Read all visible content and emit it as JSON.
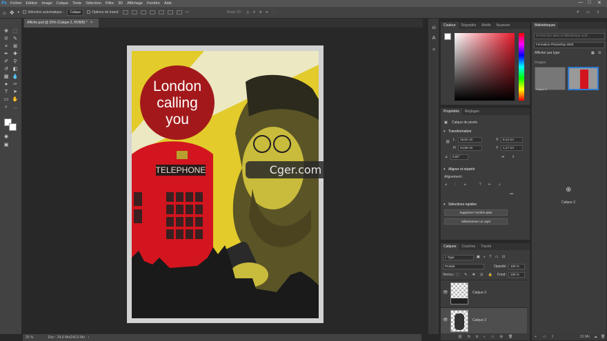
{
  "menubar": {
    "logo": "Ps",
    "items": [
      "Fichier",
      "Edition",
      "Image",
      "Calque",
      "Texte",
      "Sélection",
      "Filtre",
      "3D",
      "Affichage",
      "Fenêtre",
      "Aide"
    ],
    "minimize": "—",
    "maximize": "□",
    "close": "✕"
  },
  "options": {
    "auto_select_label": "Sélection automatique :",
    "auto_select_value": "Calque",
    "transform_label": "Options de transf.",
    "mode3d_label": "Mode 3D :"
  },
  "document": {
    "tab_title": "Affiche.psd @ 25% (Calque 2, RVB/8) *",
    "tab_close": "×",
    "zoom": "25 %",
    "doc_info": "Doc : 24,9 Mo/242,5 Mo"
  },
  "poster": {
    "headline_line1": "London",
    "headline_line2": "calling",
    "headline_line3": "you",
    "booth_sign": "TELEPHONE",
    "colors": {
      "yellow": "#e2cb2a",
      "cream": "#ece8c2",
      "red": "#a3191b",
      "booth_red": "#d2151e",
      "silhouette": "#1a1a1a"
    }
  },
  "watermark": {
    "text": "Cger.com"
  },
  "color_panel": {
    "tabs": [
      "Couleur",
      "Dégradés",
      "Motifs",
      "Nuancier"
    ]
  },
  "properties_panel": {
    "tabs": [
      "Propriétés",
      "Réglages"
    ],
    "layer_kind": "Calque de pixels",
    "transform_section": "Transformation",
    "w_label": "L",
    "w_value": "15,91 cm",
    "h_label": "H",
    "h_value": "24,86 cm",
    "x_label": "X",
    "x_value": "9,14 cm",
    "y_label": "Y",
    "y_value": "1,17 cm",
    "angle_value": "0,00°",
    "align_section": "Aligner et répartir",
    "align_label": "Alignement :",
    "more": "•••",
    "quick_section": "Sélections rapides",
    "remove_bg_button": "Supprimer l'arrière-plan",
    "select_subject_button": "Sélectionner un sujet"
  },
  "layers_panel": {
    "tabs": [
      "Calques",
      "Couches",
      "Tracés"
    ],
    "filter_type": "Type",
    "blend_mode": "Produit",
    "opacity_label": "Opacité :",
    "opacity_value": "100 %",
    "lock_label": "Verrou :",
    "fill_label": "Fond :",
    "fill_value": "100 %",
    "layers": [
      {
        "name": "Calque 3"
      },
      {
        "name": "Calque 2"
      }
    ],
    "footer_icons": "fx"
  },
  "libraries_panel": {
    "tab": "Bibliothèques",
    "search_placeholder": "Rechercher dans la bibliothèque actif...",
    "library_name": "Formation Photoshop 2020",
    "view_label": "Afficher par type",
    "section": "Images",
    "thumb1_label": "Calque 2",
    "add_label": "Calque 2",
    "status_size": "21 Mo"
  }
}
